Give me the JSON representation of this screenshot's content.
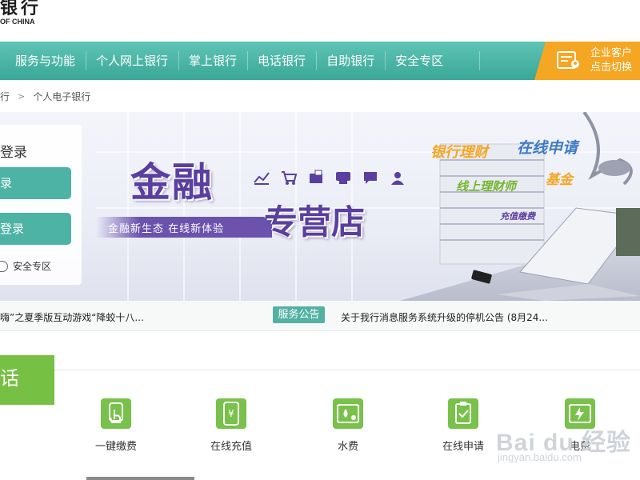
{
  "header": {
    "logo_cn": "银行",
    "logo_en": "OF CHINA"
  },
  "nav": {
    "items": [
      {
        "label": "服务与功能"
      },
      {
        "label": "个人网上银行"
      },
      {
        "label": "掌上银行"
      },
      {
        "label": "电话银行"
      },
      {
        "label": "自助银行"
      },
      {
        "label": "安全专区"
      }
    ],
    "corp_switch": {
      "line1": "企业客户",
      "line2": "点击切换"
    }
  },
  "breadcrumb": {
    "items": [
      "行",
      "个人电子银行"
    ]
  },
  "login": {
    "title": "登录",
    "btn1": "录",
    "btn2": "登录",
    "security": "安全专区"
  },
  "banner": {
    "main": "金融",
    "store": "专营店",
    "subtitle": "金融新生态 在线新体验",
    "words": [
      "银行理财",
      "在线申请",
      "线上理财师",
      "基金",
      "充值缴费"
    ]
  },
  "ticker": {
    "left": "嗨”之夏季版互动游戏“降蛟十八...",
    "badge": "服务公告",
    "right": "关于我行消息服务系统升级的停机公告 (8月24..."
  },
  "section": {
    "tab": "话"
  },
  "services": [
    {
      "label": "一键缴费",
      "icon": "tap-icon"
    },
    {
      "label": "在线充值",
      "icon": "phone-yuan-icon"
    },
    {
      "label": "水费",
      "icon": "water-bill-icon"
    },
    {
      "label": "在线申请",
      "icon": "clipboard-check-icon"
    },
    {
      "label": "电费",
      "icon": "electricity-bill-icon"
    }
  ],
  "watermark": {
    "text": "Bai du 经验",
    "sub": "jingyan.baidu.com"
  },
  "colors": {
    "nav": "#3aa797",
    "corp": "#f5a623",
    "green": "#78c14a",
    "accent": "#4cb3a5",
    "purple": "#5a3fa0"
  }
}
